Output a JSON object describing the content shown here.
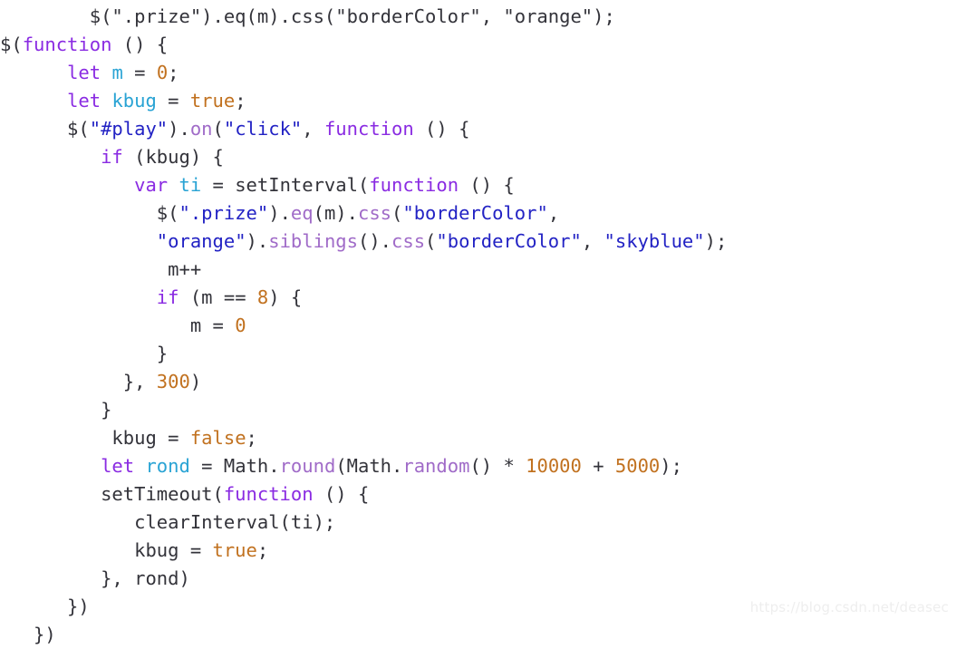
{
  "editor": {
    "language": "javascript",
    "background_color": "#ffffff",
    "font_size_px": 20.5,
    "line_height_px": 31,
    "token_colors": {
      "plain": "#33333a",
      "keyword": "#8a2be2",
      "variable": "#29a3d4",
      "string": "#2222c4",
      "number": "#c1711f",
      "method": "#a06bc8"
    },
    "lines": [
      {
        "n": 0,
        "clipped": true,
        "tokens": [
          {
            "t": "plain",
            "s": "        $(\".prize\").eq(m).css(\"borderColor\", \"orange\");"
          }
        ]
      },
      {
        "n": 1,
        "tokens": [
          {
            "t": "plain",
            "s": "$("
          },
          {
            "t": "kw",
            "s": "function"
          },
          {
            "t": "plain",
            "s": " () {"
          }
        ]
      },
      {
        "n": 2,
        "tokens": [
          {
            "t": "plain",
            "s": "      "
          },
          {
            "t": "kw",
            "s": "let"
          },
          {
            "t": "plain",
            "s": " "
          },
          {
            "t": "var",
            "s": "m"
          },
          {
            "t": "plain",
            "s": " = "
          },
          {
            "t": "num",
            "s": "0"
          },
          {
            "t": "plain",
            "s": ";"
          }
        ]
      },
      {
        "n": 3,
        "tokens": [
          {
            "t": "plain",
            "s": "      "
          },
          {
            "t": "kw",
            "s": "let"
          },
          {
            "t": "plain",
            "s": " "
          },
          {
            "t": "var",
            "s": "kbug"
          },
          {
            "t": "plain",
            "s": " = "
          },
          {
            "t": "num",
            "s": "true"
          },
          {
            "t": "plain",
            "s": ";"
          }
        ]
      },
      {
        "n": 4,
        "tokens": [
          {
            "t": "plain",
            "s": "      $("
          },
          {
            "t": "str",
            "s": "\"#play\""
          },
          {
            "t": "plain",
            "s": ")."
          },
          {
            "t": "method",
            "s": "on"
          },
          {
            "t": "plain",
            "s": "("
          },
          {
            "t": "str",
            "s": "\"click\""
          },
          {
            "t": "plain",
            "s": ", "
          },
          {
            "t": "kw",
            "s": "function"
          },
          {
            "t": "plain",
            "s": " () {"
          }
        ]
      },
      {
        "n": 5,
        "tokens": [
          {
            "t": "plain",
            "s": "         "
          },
          {
            "t": "kw",
            "s": "if"
          },
          {
            "t": "plain",
            "s": " (kbug) {"
          }
        ]
      },
      {
        "n": 6,
        "tokens": [
          {
            "t": "plain",
            "s": "            "
          },
          {
            "t": "kw",
            "s": "var"
          },
          {
            "t": "plain",
            "s": " "
          },
          {
            "t": "var",
            "s": "ti"
          },
          {
            "t": "plain",
            "s": " = setInterval("
          },
          {
            "t": "kw",
            "s": "function"
          },
          {
            "t": "plain",
            "s": " () {"
          }
        ]
      },
      {
        "n": 7,
        "tokens": [
          {
            "t": "plain",
            "s": "              $("
          },
          {
            "t": "str",
            "s": "\".prize\""
          },
          {
            "t": "plain",
            "s": ")."
          },
          {
            "t": "method",
            "s": "eq"
          },
          {
            "t": "plain",
            "s": "(m)."
          },
          {
            "t": "method",
            "s": "css"
          },
          {
            "t": "plain",
            "s": "("
          },
          {
            "t": "str",
            "s": "\"borderColor\""
          },
          {
            "t": "plain",
            "s": ","
          }
        ]
      },
      {
        "n": 8,
        "tokens": [
          {
            "t": "plain",
            "s": "              "
          },
          {
            "t": "str",
            "s": "\"orange\""
          },
          {
            "t": "plain",
            "s": ")."
          },
          {
            "t": "method",
            "s": "siblings"
          },
          {
            "t": "plain",
            "s": "()."
          },
          {
            "t": "method",
            "s": "css"
          },
          {
            "t": "plain",
            "s": "("
          },
          {
            "t": "str",
            "s": "\"borderColor\""
          },
          {
            "t": "plain",
            "s": ", "
          },
          {
            "t": "str",
            "s": "\"skyblue\""
          },
          {
            "t": "plain",
            "s": ");"
          }
        ]
      },
      {
        "n": 9,
        "tokens": [
          {
            "t": "plain",
            "s": "               m++"
          }
        ]
      },
      {
        "n": 10,
        "tokens": [
          {
            "t": "plain",
            "s": "              "
          },
          {
            "t": "kw",
            "s": "if"
          },
          {
            "t": "plain",
            "s": " (m == "
          },
          {
            "t": "num",
            "s": "8"
          },
          {
            "t": "plain",
            "s": ") {"
          }
        ]
      },
      {
        "n": 11,
        "tokens": [
          {
            "t": "plain",
            "s": "                 m = "
          },
          {
            "t": "num",
            "s": "0"
          }
        ]
      },
      {
        "n": 12,
        "tokens": [
          {
            "t": "plain",
            "s": "              }"
          }
        ]
      },
      {
        "n": 13,
        "tokens": [
          {
            "t": "plain",
            "s": "           }, "
          },
          {
            "t": "num",
            "s": "300"
          },
          {
            "t": "plain",
            "s": ")"
          }
        ]
      },
      {
        "n": 14,
        "tokens": [
          {
            "t": "plain",
            "s": "         }"
          }
        ]
      },
      {
        "n": 15,
        "tokens": [
          {
            "t": "plain",
            "s": "          kbug = "
          },
          {
            "t": "num",
            "s": "false"
          },
          {
            "t": "plain",
            "s": ";"
          }
        ]
      },
      {
        "n": 16,
        "tokens": [
          {
            "t": "plain",
            "s": "         "
          },
          {
            "t": "kw",
            "s": "let"
          },
          {
            "t": "plain",
            "s": " "
          },
          {
            "t": "var",
            "s": "rond"
          },
          {
            "t": "plain",
            "s": " = Math."
          },
          {
            "t": "method",
            "s": "round"
          },
          {
            "t": "plain",
            "s": "(Math."
          },
          {
            "t": "method",
            "s": "random"
          },
          {
            "t": "plain",
            "s": "() * "
          },
          {
            "t": "num",
            "s": "10000"
          },
          {
            "t": "plain",
            "s": " + "
          },
          {
            "t": "num",
            "s": "5000"
          },
          {
            "t": "plain",
            "s": ");"
          }
        ]
      },
      {
        "n": 17,
        "tokens": [
          {
            "t": "plain",
            "s": "         setTimeout("
          },
          {
            "t": "kw",
            "s": "function"
          },
          {
            "t": "plain",
            "s": " () {"
          }
        ]
      },
      {
        "n": 18,
        "tokens": [
          {
            "t": "plain",
            "s": "            clearInterval(ti);"
          }
        ]
      },
      {
        "n": 19,
        "tokens": [
          {
            "t": "plain",
            "s": "            kbug = "
          },
          {
            "t": "num",
            "s": "true"
          },
          {
            "t": "plain",
            "s": ";"
          }
        ]
      },
      {
        "n": 20,
        "tokens": [
          {
            "t": "plain",
            "s": "         }, rond)"
          }
        ]
      },
      {
        "n": 21,
        "tokens": [
          {
            "t": "plain",
            "s": "      })"
          }
        ]
      },
      {
        "n": 22,
        "tokens": [
          {
            "t": "plain",
            "s": "   })"
          }
        ]
      }
    ]
  },
  "watermark": {
    "text": "https://blog.csdn.net/deasec",
    "color": "#eeeeee"
  }
}
